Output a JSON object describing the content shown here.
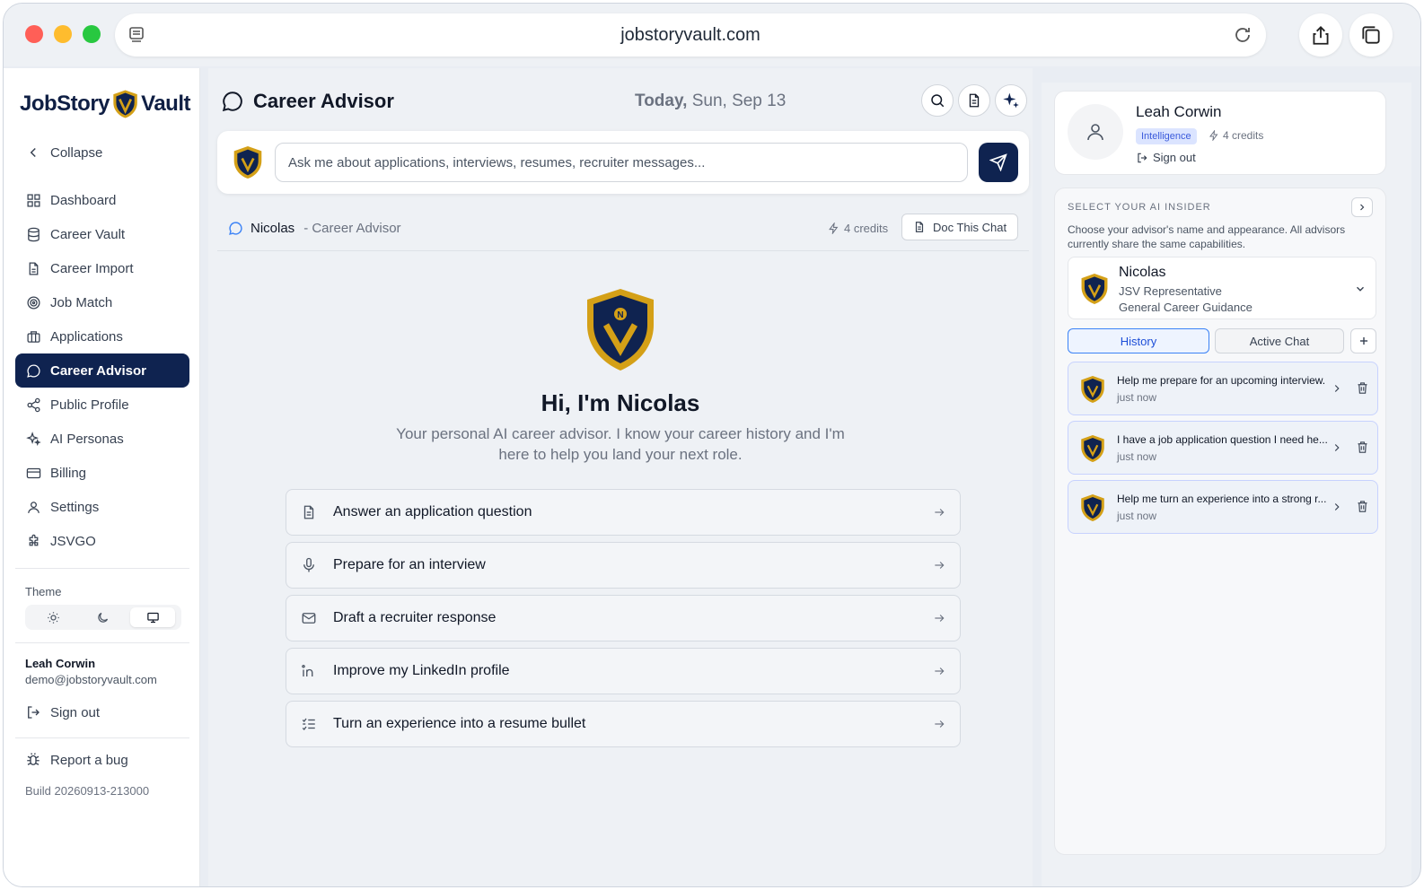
{
  "browser": {
    "url": "jobstoryvault.com"
  },
  "sidebar": {
    "logo": {
      "left": "JobStory",
      "right": "Vault"
    },
    "collapse_label": "Collapse",
    "nav": [
      {
        "label": "Dashboard",
        "icon": "grid-icon"
      },
      {
        "label": "Career Vault",
        "icon": "database-icon"
      },
      {
        "label": "Career Import",
        "icon": "file-import-icon"
      },
      {
        "label": "Job Match",
        "icon": "target-icon"
      },
      {
        "label": "Applications",
        "icon": "briefcase-icon"
      },
      {
        "label": "Career Advisor",
        "icon": "chat-bubble-icon",
        "active": true
      },
      {
        "label": "Public Profile",
        "icon": "share-icon"
      },
      {
        "label": "AI Personas",
        "icon": "sparkles-icon"
      },
      {
        "label": "Billing",
        "icon": "credit-card-icon"
      },
      {
        "label": "Settings",
        "icon": "user-icon"
      },
      {
        "label": "JSVGO",
        "icon": "puzzle-icon"
      }
    ],
    "theme_label": "Theme",
    "user": {
      "name": "Leah Corwin",
      "email": "demo@jobstoryvault.com"
    },
    "signout_label": "Sign out",
    "report_bug_label": "Report a bug",
    "build": "Build 20260913-213000"
  },
  "main": {
    "title": "Career Advisor",
    "date_prefix": "Today,",
    "date": "Sun, Sep 13",
    "ask_placeholder": "Ask me about applications, interviews, resumes, recruiter messages...",
    "chat_header": {
      "advisor_name": "Nicolas",
      "advisor_role": "- Career Advisor",
      "credits": "4 credits",
      "doc_button": "Doc This Chat"
    },
    "hero": {
      "title": "Hi, I'm Nicolas",
      "subtitle": "Your personal AI career advisor. I know your career history and I'm here to help you land your next role."
    },
    "suggestions": [
      {
        "label": "Answer an application question",
        "icon": "document-icon"
      },
      {
        "label": "Prepare for an interview",
        "icon": "microphone-icon"
      },
      {
        "label": "Draft a recruiter response",
        "icon": "mail-icon"
      },
      {
        "label": "Improve my LinkedIn profile",
        "icon": "linkedin-icon"
      },
      {
        "label": "Turn an experience into a resume bullet",
        "icon": "list-check-icon"
      }
    ]
  },
  "right_panel": {
    "profile": {
      "name": "Leah Corwin",
      "badge": "Intelligence",
      "credits": "4 credits",
      "signout": "Sign out"
    },
    "insider": {
      "heading": "SELECT YOUR AI INSIDER",
      "description": "Choose your advisor's name and appearance. All advisors currently share the same capabilities.",
      "advisor": {
        "name": "Nicolas",
        "role": "JSV Representative",
        "focus": "General Career Guidance"
      },
      "tabs": {
        "history": "History",
        "active_chat": "Active Chat"
      },
      "history": [
        {
          "title": "Help me prepare for an upcoming interview.",
          "time": "just now"
        },
        {
          "title": "I have a job application question I need he...",
          "time": "just now"
        },
        {
          "title": "Help me turn an experience into a strong r...",
          "time": "just now"
        }
      ]
    }
  },
  "colors": {
    "navy": "#0f2350",
    "gold": "#d4a017",
    "accent_blue": "#3b82f6"
  }
}
